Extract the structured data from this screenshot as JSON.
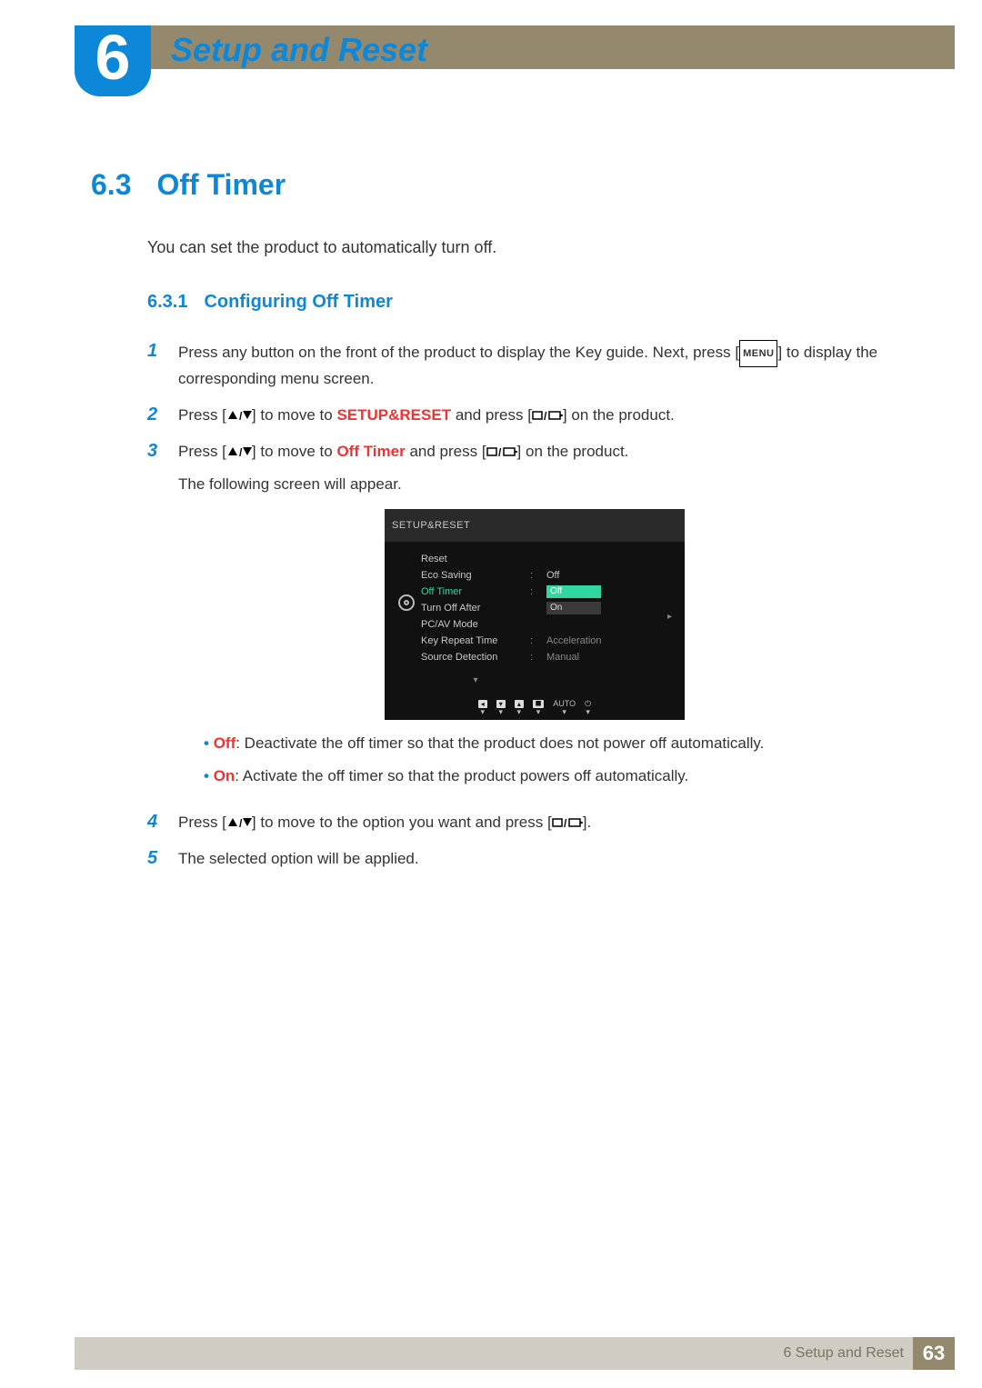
{
  "chapter": {
    "number": "6",
    "title": "Setup and Reset"
  },
  "section": {
    "number": "6.3",
    "title": "Off Timer"
  },
  "lead": "You can set the product to automatically turn off.",
  "subsection": {
    "number": "6.3.1",
    "title": "Configuring Off Timer"
  },
  "steps": {
    "s1_a": "Press any button on the front of the product to display the Key guide. Next, press [",
    "s1_menu": "MENU",
    "s1_b": "] to display the corresponding menu screen.",
    "s2_a": "Press [",
    "s2_b": "] to move to ",
    "s2_kw": "SETUP&RESET",
    "s2_c": " and press [",
    "s2_d": "] on the product.",
    "s3_a": "Press [",
    "s3_b": "] to move to ",
    "s3_kw": "Off Timer",
    "s3_c": " and press [",
    "s3_d": "] on the product.",
    "s3_note": "The following screen will appear.",
    "s4_a": "Press [",
    "s4_b": "] to move to the option you want and press [",
    "s4_c": "].",
    "s5": "The selected option will be applied."
  },
  "options": {
    "off_label": "Off",
    "off_text": ": Deactivate the off timer so that the product does not power off automatically.",
    "on_label": "On",
    "on_text": ": Activate the off timer so that the product powers off automatically."
  },
  "osd": {
    "title": "SETUP&RESET",
    "items": {
      "reset": "Reset",
      "eco": "Eco Saving",
      "eco_val": "Off",
      "offtimer": "Off Timer",
      "offtimer_off": "Off",
      "offtimer_on": "On",
      "turnoff": "Turn Off After",
      "pcav": "PC/AV Mode",
      "keyrepeat": "Key Repeat Time",
      "keyrepeat_val": "Acceleration",
      "srcdet": "Source Detection",
      "srcdet_val": "Manual"
    },
    "footer": {
      "auto": "AUTO"
    }
  },
  "footer": {
    "chapter_label": "6 Setup and Reset",
    "page_number": "63"
  }
}
